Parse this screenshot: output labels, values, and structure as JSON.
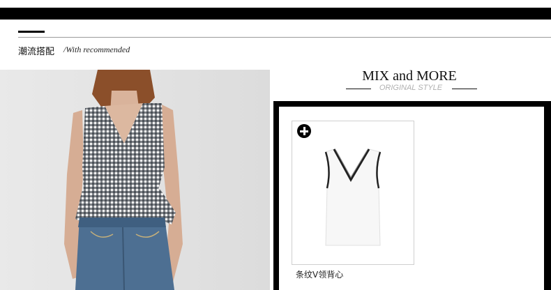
{
  "section": {
    "title": "潮流搭配",
    "subtitle": "/With recommended"
  },
  "mix": {
    "title": "MIX and MORE",
    "subtitle": "ORIGINAL STYLE"
  },
  "product": {
    "name": "条纹V领背心",
    "add_icon": "plus-circle-icon"
  },
  "colors": {
    "bar": "#000000",
    "subtitle": "#b0b0b0",
    "photo_bg": "#e4e4e4",
    "gingham": "#1f2630",
    "denim": "#4d6f92"
  }
}
